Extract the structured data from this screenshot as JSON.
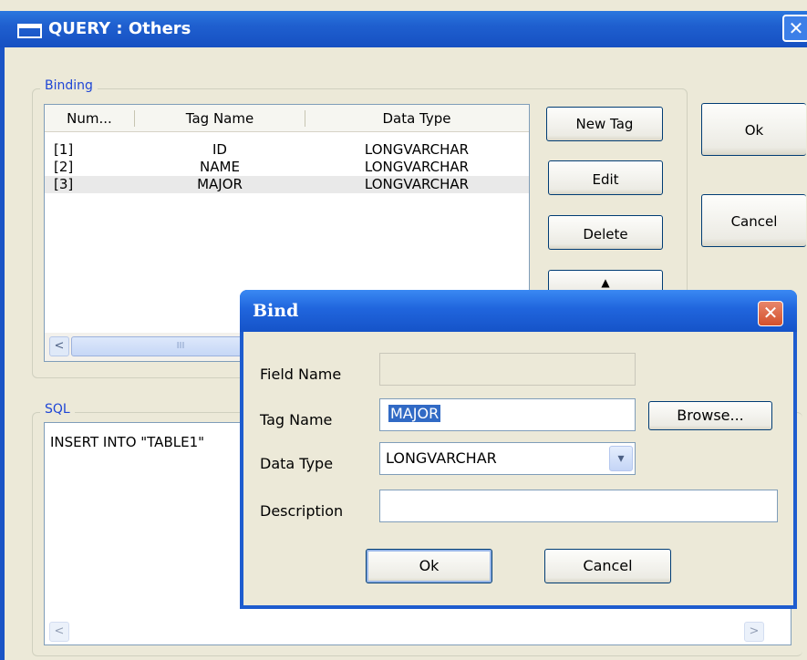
{
  "window": {
    "title": "QUERY : Others",
    "close_glyph": "✕"
  },
  "binding": {
    "label": "Binding",
    "columns": [
      "Num...",
      "Tag Name",
      "Data Type"
    ],
    "rows": [
      {
        "num": "[1]",
        "tag": "ID",
        "type": "LONGVARCHAR"
      },
      {
        "num": "[2]",
        "tag": "NAME",
        "type": "LONGVARCHAR"
      },
      {
        "num": "[3]",
        "tag": "MAJOR",
        "type": "LONGVARCHAR"
      }
    ],
    "scroll_left": "<",
    "scroll_thumb": "III"
  },
  "side_buttons": {
    "new_tag": "New Tag",
    "edit": "Edit",
    "delete": "Delete",
    "up": "▲"
  },
  "main_buttons": {
    "ok": "Ok",
    "cancel": "Cancel"
  },
  "sql": {
    "label": "SQL",
    "text": "INSERT INTO \"TABLE1\"",
    "scroll_left": "<",
    "scroll_right": ">"
  },
  "bind_dialog": {
    "title": "Bind",
    "close_glyph": "✕",
    "field_name_label": "Field Name",
    "field_name_value": "",
    "tag_name_label": "Tag Name",
    "tag_name_value": "MAJOR",
    "browse_label": "Browse...",
    "data_type_label": "Data Type",
    "data_type_value": "LONGVARCHAR",
    "combo_glyph": "▾",
    "description_label": "Description",
    "description_value": "",
    "ok_label": "Ok",
    "cancel_label": "Cancel"
  },
  "colors": {
    "titlebar": "#1f5fcf",
    "group_label": "#1f46d6",
    "selection": "#316ac5"
  }
}
